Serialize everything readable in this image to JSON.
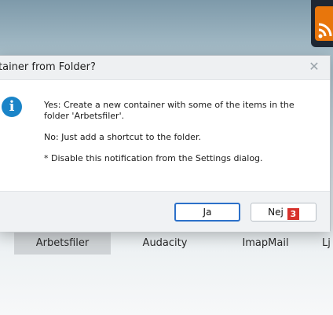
{
  "dialog": {
    "title": "tainer from Folder?",
    "message_yes": "Yes: Create a new container with some of the items in the folder 'Arbetsfiler'.",
    "message_no": "No: Just add a shortcut to the folder.",
    "message_note": "* Disable this notification from the Settings dialog.",
    "buttons": {
      "yes": "Ja",
      "no": "Nej",
      "no_badge": "3"
    },
    "close_glyph": "✕"
  },
  "taskbar": {
    "items": [
      "Arbetsfiler",
      "Audacity",
      "ImapMail",
      "Lj"
    ]
  },
  "icons": {
    "dialog_icon": "info-icon",
    "info_glyph": "i",
    "tray_icon": "rss-feed-icon"
  },
  "colors": {
    "accent": "#2c70c9",
    "info": "#1a84c8",
    "badge": "#d7322c",
    "rss": "#e8760c"
  }
}
